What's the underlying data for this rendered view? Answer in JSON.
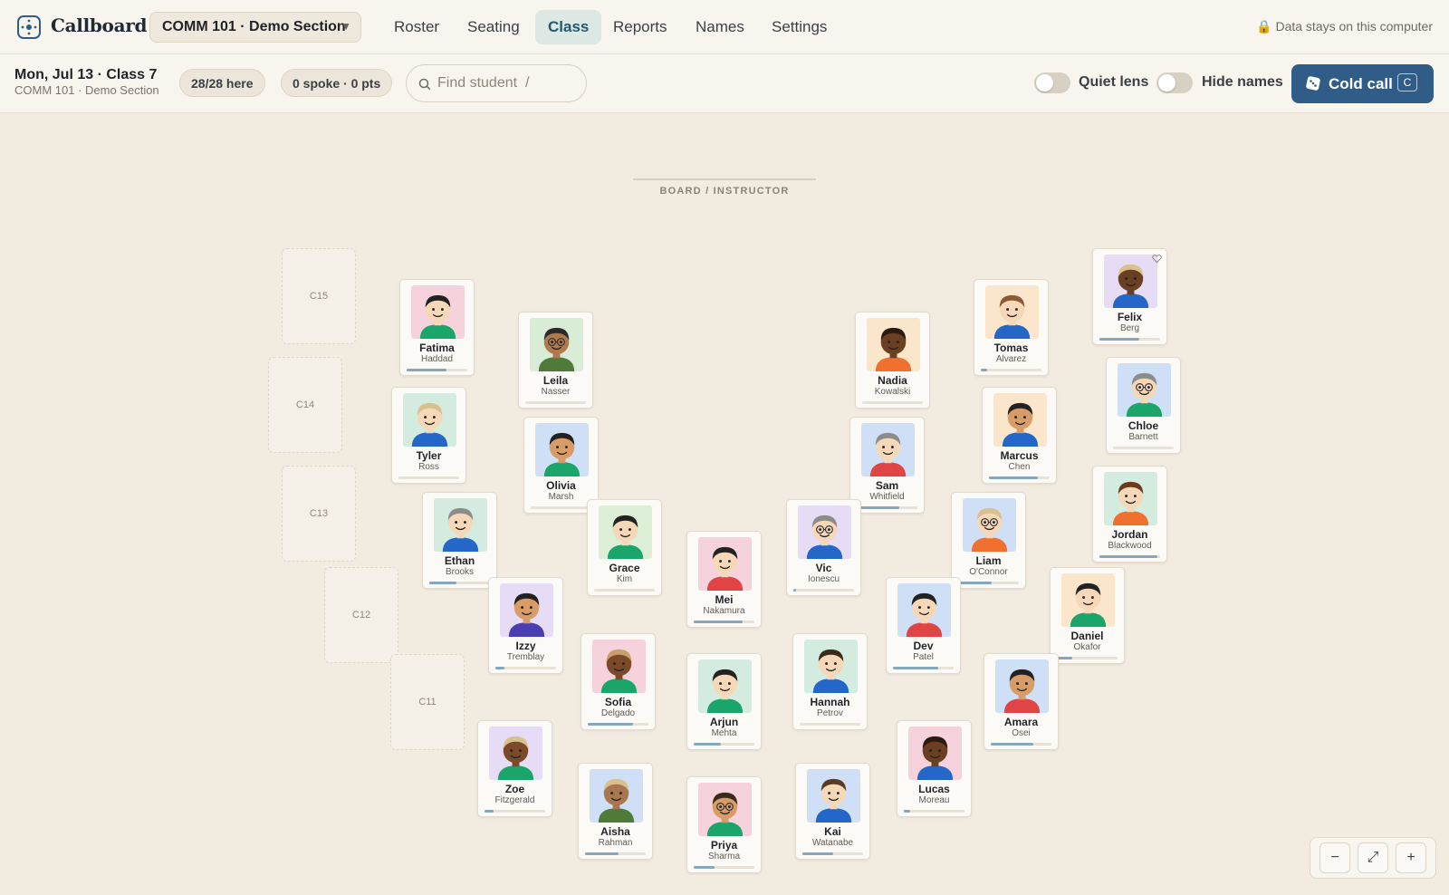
{
  "app": {
    "brand": "Callboard",
    "section": "COMM 101 · Demo Section",
    "privacy": "Data stays on this computer"
  },
  "nav": [
    "Roster",
    "Seating",
    "Class",
    "Reports",
    "Names",
    "Settings"
  ],
  "nav_active": "Class",
  "session": {
    "title": "Mon, Jul 13 · Class 7",
    "section": "COMM 101 · Demo Section",
    "attendance": "28/28 here",
    "participation": "0 spoke · 0 pts",
    "search_placeholder": "Find student  /",
    "quiet_lens": "Quiet lens",
    "hide_names": "Hide names",
    "cold_call": "Cold call",
    "cold_call_key": "C"
  },
  "board_label": "BOARD / INSTRUCTOR",
  "empty_seats": [
    "C15",
    "C14",
    "C13",
    "C12",
    "C11"
  ],
  "students": [
    {
      "first": "Fatima",
      "last": "Haddad",
      "bg": "#f6d3dc",
      "skin": "#f6d7b8",
      "hair": "#222222",
      "shirt": "#1aa56b",
      "glasses": false,
      "progress": 0.65
    },
    {
      "first": "Leila",
      "last": "Nasser",
      "bg": "#d9ecd5",
      "skin": "#b07a4f",
      "hair": "#2a2a2a",
      "shirt": "#4f7a3a",
      "glasses": true,
      "progress": 0.0
    },
    {
      "first": "Tyler",
      "last": "Ross",
      "bg": "#d3ecdf",
      "skin": "#f6d7b8",
      "hair": "#d8c18c",
      "shirt": "#2467c9",
      "glasses": false,
      "progress": 0.0
    },
    {
      "first": "Olivia",
      "last": "Marsh",
      "bg": "#cfe0f6",
      "skin": "#d89c66",
      "hair": "#222222",
      "shirt": "#1aa56b",
      "glasses": false,
      "progress": 0.0
    },
    {
      "first": "Ethan",
      "last": "Brooks",
      "bg": "#d3ecdf",
      "skin": "#f6d7b8",
      "hair": "#8c8c8c",
      "shirt": "#2467c9",
      "glasses": false,
      "progress": 0.45
    },
    {
      "first": "Grace",
      "last": "Kim",
      "bg": "#dcefd6",
      "skin": "#f6d7b8",
      "hair": "#222222",
      "shirt": "#1aa56b",
      "glasses": false,
      "progress": 0.0
    },
    {
      "first": "Izzy",
      "last": "Tremblay",
      "bg": "#e6dcf6",
      "skin": "#d89c66",
      "hair": "#222222",
      "shirt": "#4a3fb0",
      "glasses": false,
      "progress": 0.15
    },
    {
      "first": "Mei",
      "last": "Nakamura",
      "bg": "#f6d3dc",
      "skin": "#f6d7b8",
      "hair": "#222222",
      "shirt": "#e04444",
      "glasses": false,
      "progress": 0.8
    },
    {
      "first": "Sofia",
      "last": "Delgado",
      "bg": "#f6d3dc",
      "skin": "#7a4a2a",
      "hair": "#c9a06a",
      "shirt": "#1aa56b",
      "glasses": false,
      "progress": 0.75
    },
    {
      "first": "Zoe",
      "last": "Fitzgerald",
      "bg": "#e6dcf6",
      "skin": "#7a4a2a",
      "hair": "#d8c18c",
      "shirt": "#1aa56b",
      "glasses": false,
      "progress": 0.15
    },
    {
      "first": "Arjun",
      "last": "Mehta",
      "bg": "#d3ecdf",
      "skin": "#f6d7b8",
      "hair": "#222222",
      "shirt": "#1aa56b",
      "glasses": false,
      "progress": 0.45
    },
    {
      "first": "Aisha",
      "last": "Rahman",
      "bg": "#cfe0f6",
      "skin": "#a9774f",
      "hair": "#d8c18c",
      "shirt": "#4f7a3a",
      "glasses": false,
      "progress": 0.55
    },
    {
      "first": "Priya",
      "last": "Sharma",
      "bg": "#f6d3dc",
      "skin": "#d89c66",
      "hair": "#3a2a1a",
      "shirt": "#1aa56b",
      "glasses": true,
      "progress": 0.35
    },
    {
      "first": "Nadia",
      "last": "Kowalski",
      "bg": "#fbe6cc",
      "skin": "#6a3f22",
      "hair": "#2a1a10",
      "shirt": "#f07030",
      "glasses": false,
      "progress": 0.0
    },
    {
      "first": "Tomas",
      "last": "Alvarez",
      "bg": "#fbe6cc",
      "skin": "#f6d7b8",
      "hair": "#8a5a35",
      "shirt": "#2467c9",
      "glasses": false,
      "progress": 0.1
    },
    {
      "first": "Felix",
      "last": "Berg",
      "bg": "#e6dcf6",
      "skin": "#6a3f22",
      "hair": "#d8c18c",
      "shirt": "#2467c9",
      "glasses": false,
      "progress": 0.65,
      "heart": true
    },
    {
      "first": "Sam",
      "last": "Whitfield",
      "bg": "#cfe0f6",
      "skin": "#f6d7b8",
      "hair": "#8c8c8c",
      "shirt": "#e04444",
      "glasses": false,
      "progress": 0.7
    },
    {
      "first": "Marcus",
      "last": "Chen",
      "bg": "#fbe6cc",
      "skin": "#d89c66",
      "hair": "#222222",
      "shirt": "#2467c9",
      "glasses": false,
      "progress": 0.8
    },
    {
      "first": "Chloe",
      "last": "Barnett",
      "bg": "#cfe0f6",
      "skin": "#f6d7b8",
      "hair": "#8c8c8c",
      "shirt": "#1aa56b",
      "glasses": true,
      "progress": 0.0
    },
    {
      "first": "Vic",
      "last": "Ionescu",
      "bg": "#e6dcf6",
      "skin": "#f6d7b8",
      "hair": "#8c8c8c",
      "shirt": "#2467c9",
      "glasses": true,
      "progress": 0.05
    },
    {
      "first": "Liam",
      "last": "O'Connor",
      "bg": "#cfe0f6",
      "skin": "#f6d7b8",
      "hair": "#d8c18c",
      "shirt": "#f07030",
      "glasses": true,
      "progress": 0.55
    },
    {
      "first": "Jordan",
      "last": "Blackwood",
      "bg": "#d3ecdf",
      "skin": "#f6d7b8",
      "hair": "#6a3a1a",
      "shirt": "#f07030",
      "glasses": false,
      "progress": 0.95
    },
    {
      "first": "Dev",
      "last": "Patel",
      "bg": "#cfe0f6",
      "skin": "#f6d7b8",
      "hair": "#222222",
      "shirt": "#e04444",
      "glasses": false,
      "progress": 0.75
    },
    {
      "first": "Daniel",
      "last": "Okafor",
      "bg": "#fbe6cc",
      "skin": "#f6d7b8",
      "hair": "#222222",
      "shirt": "#1aa56b",
      "glasses": false,
      "progress": 0.25
    },
    {
      "first": "Hannah",
      "last": "Petrov",
      "bg": "#d3ecdf",
      "skin": "#f6d7b8",
      "hair": "#3a2a1a",
      "shirt": "#2467c9",
      "glasses": false,
      "progress": 0.0
    },
    {
      "first": "Amara",
      "last": "Osei",
      "bg": "#cfe0f6",
      "skin": "#d89c66",
      "hair": "#222222",
      "shirt": "#e04444",
      "glasses": false,
      "progress": 0.7
    },
    {
      "first": "Lucas",
      "last": "Moreau",
      "bg": "#f6d3dc",
      "skin": "#6a3f22",
      "hair": "#2a1a10",
      "shirt": "#2467c9",
      "glasses": false,
      "progress": 0.1
    },
    {
      "first": "Kai",
      "last": "Watanabe",
      "bg": "#cfe0f6",
      "skin": "#f6d7b8",
      "hair": "#5a3a22",
      "shirt": "#2467c9",
      "glasses": false,
      "progress": 0.5
    }
  ],
  "zoom_controls": {
    "out": "−",
    "fit": "⤢",
    "in": "+"
  },
  "colors": {
    "accent": "#2f5d87",
    "nav_active_bg": "#dbe8e4",
    "nav_active_text": "#245a6b",
    "canvas": "#f1ebe0"
  }
}
